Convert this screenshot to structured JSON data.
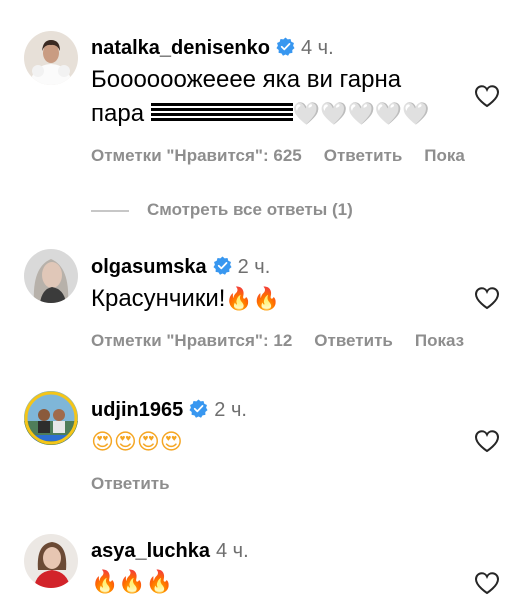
{
  "comments": [
    {
      "username": "natalka_denisenko",
      "verified": true,
      "time": "4 ч.",
      "text_line1": "Боооооожееее яка ви гарна",
      "text_line2": "пара",
      "text_line2_emoji": "🤍🤍🤍🤍🤍",
      "likes": "Отметки \"Нравится\": 625",
      "reply": "Ответить",
      "extra": "Пока"
    },
    {
      "username": "olgasumska",
      "verified": true,
      "time": "2 ч.",
      "text": "Красунчики!",
      "text_emoji": "🔥🔥",
      "likes": "Отметки \"Нравится\": 12",
      "reply": "Ответить",
      "extra": "Показ"
    },
    {
      "username": "udjin1965",
      "verified": true,
      "time": "2 ч.",
      "text_emoji": "😍😍😍😍",
      "reply": "Ответить"
    },
    {
      "username": "asya_luchka",
      "verified": false,
      "time": "4 ч.",
      "text_emoji": "🔥🔥🔥"
    }
  ],
  "view_replies": "Смотреть все ответы (1)",
  "colors": {
    "verified": "#3897f0",
    "meta_text": "#8e8e8e",
    "time_text": "#6f6f6f"
  }
}
